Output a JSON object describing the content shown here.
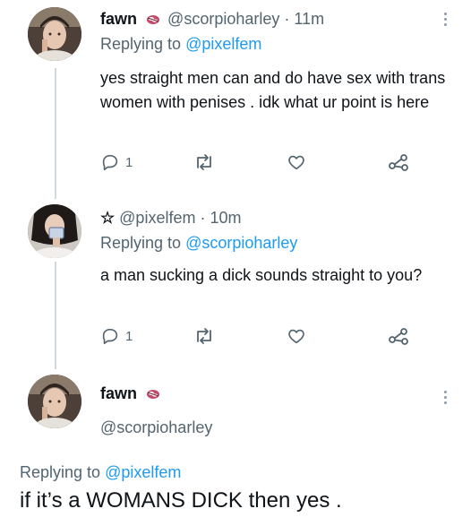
{
  "tweets": [
    {
      "display_name": "fawn",
      "handle": "@scorpioharley",
      "separator": "·",
      "time": "11m",
      "replying_prefix": "Replying to",
      "replying_to": "@pixelfem",
      "text": "yes straight men can and do have sex with trans women with penises . idk what ur point is here",
      "reply_count": "1",
      "avatar_icon": "profile-photo"
    },
    {
      "star": "☆",
      "handle": "@pixelfem",
      "separator": "·",
      "time": "10m",
      "replying_prefix": "Replying to",
      "replying_to": "@scorpioharley",
      "text": "a man sucking a dick sounds straight to you?",
      "reply_count": "1",
      "avatar_icon": "profile-photo"
    }
  ],
  "focal_tweet": {
    "display_name": "fawn",
    "handle": "@scorpioharley",
    "replying_prefix": "Replying to",
    "replying_to": "@pixelfem",
    "text": "if it’s a WOMANS DICK then yes .",
    "avatar_icon": "profile-photo"
  },
  "icons": {
    "reply": "reply-icon",
    "retweet": "retweet-icon",
    "like": "heart-icon",
    "share": "share-icon",
    "more": "more-icon",
    "badge": "name-emoji-icon"
  },
  "colors": {
    "text": "#0f1419",
    "secondary": "#536471",
    "link": "#1d9bf0",
    "thread_line": "#cfd9de"
  }
}
